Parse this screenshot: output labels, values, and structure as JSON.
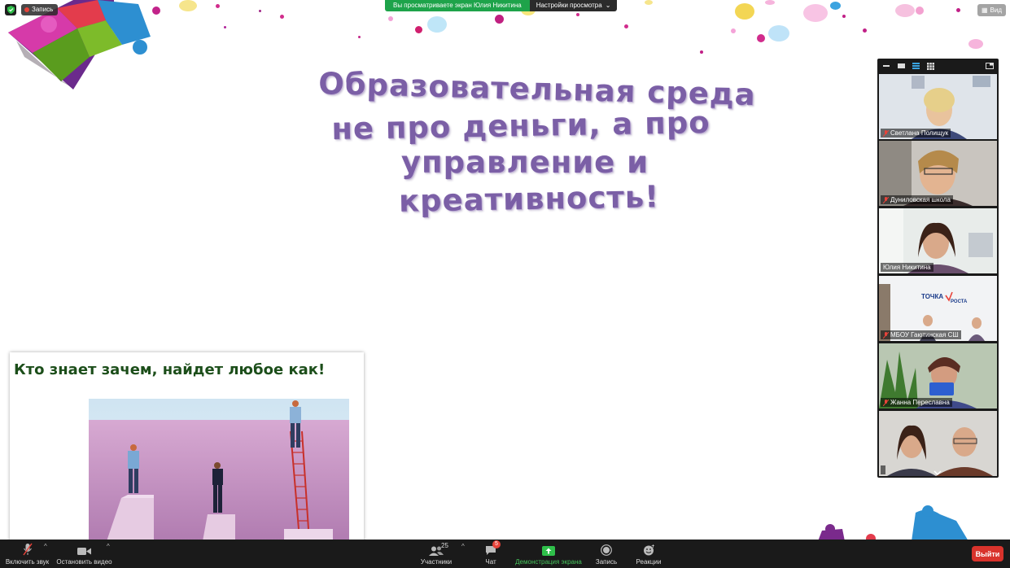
{
  "meeting": {
    "share_banner": "Вы просматриваете экран Юлия Никитина",
    "view_settings": "Настройки просмотра",
    "recording_label": "Запись",
    "view_button": "Вид"
  },
  "slide": {
    "title_lines": [
      "Образовательная среда",
      "не про деньги, а про",
      "управление и",
      "креативность!"
    ],
    "inner_heading": "Кто знает зачем, найдет любое как!"
  },
  "participants": [
    {
      "name": "Светлана Полищук",
      "muted": true
    },
    {
      "name": "Дуниловская школа",
      "muted": true
    },
    {
      "name": "Юлия Никитина",
      "muted": false,
      "active": true
    },
    {
      "name": "МБОУ Гаютинская СШ",
      "muted": true
    },
    {
      "name": "Жанна Переславна",
      "muted": true
    },
    {
      "name": "",
      "muted": false
    }
  ],
  "toolbar": {
    "unmute": "Включить звук",
    "stop_video": "Остановить видео",
    "participants": "Участники",
    "participants_count": "25",
    "chat": "Чат",
    "chat_badge": "5",
    "share_screen": "Демонстрация экрана",
    "record": "Запись",
    "reactions": "Реакции",
    "leave": "Выйти"
  },
  "colors": {
    "title_purple": "#7b5fa6",
    "heading_green": "#1c4e1a",
    "share_green": "#1ea34a",
    "leave_red": "#d9332c"
  },
  "icons": [
    "security-shield-icon",
    "record-dot-icon",
    "view-grid-icon",
    "mic-off-icon",
    "camera-icon",
    "participants-icon",
    "chat-icon",
    "share-screen-icon",
    "record-icon",
    "reactions-icon",
    "chevron-down-icon"
  ]
}
